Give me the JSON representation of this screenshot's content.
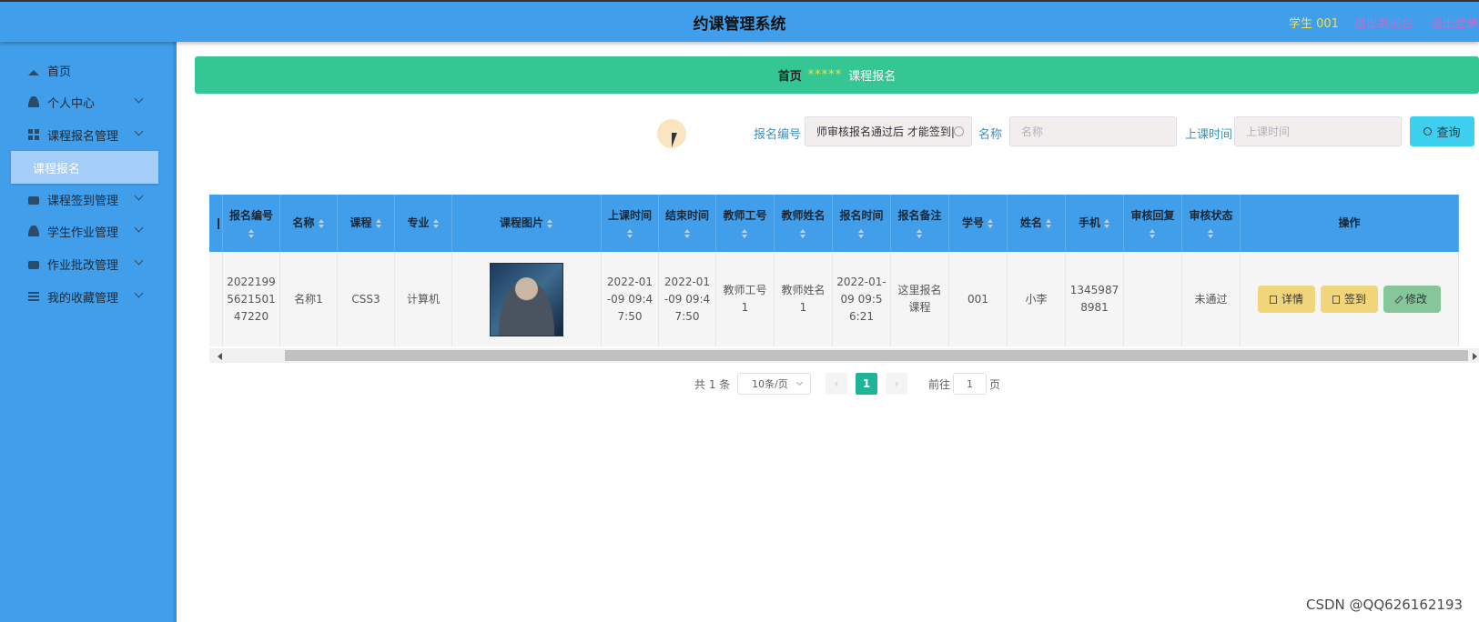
{
  "header": {
    "title": "约课管理系统",
    "user": "学生 001",
    "front_link": "退出到前台",
    "logout_link": "退出登录"
  },
  "sidebar": {
    "items": [
      {
        "label": "首页",
        "icon": "home-icon"
      },
      {
        "label": "个人中心",
        "icon": "user-icon"
      },
      {
        "label": "课程报名管理",
        "icon": "grid-icon"
      },
      {
        "label": "课程报名",
        "icon": ""
      },
      {
        "label": "课程签到管理",
        "icon": "briefcase-icon"
      },
      {
        "label": "学生作业管理",
        "icon": "user-icon"
      },
      {
        "label": "作业批改管理",
        "icon": "briefcase-icon"
      },
      {
        "label": "我的收藏管理",
        "icon": "list-icon"
      }
    ]
  },
  "breadcrumb": {
    "home": "首页",
    "separator": "*****",
    "current": "课程报名"
  },
  "search": {
    "field1_label": "报名编号",
    "field1_value": "师审核报名通过后 才能签到|",
    "field2_label": "名称",
    "field2_placeholder": "名称",
    "field3_label": "上课时间",
    "field3_placeholder": "上课时间",
    "button": "查询"
  },
  "table": {
    "columns": [
      {
        "label": "",
        "sortable": false
      },
      {
        "label": "报名编号",
        "sortable": true
      },
      {
        "label": "名称",
        "sortable": true
      },
      {
        "label": "课程",
        "sortable": true
      },
      {
        "label": "专业",
        "sortable": true
      },
      {
        "label": "课程图片",
        "sortable": true
      },
      {
        "label": "上课时间",
        "sortable": true
      },
      {
        "label": "结束时间",
        "sortable": true
      },
      {
        "label": "教师工号",
        "sortable": true
      },
      {
        "label": "教师姓名",
        "sortable": true
      },
      {
        "label": "报名时间",
        "sortable": true
      },
      {
        "label": "报名备注",
        "sortable": true
      },
      {
        "label": "学号",
        "sortable": true
      },
      {
        "label": "姓名",
        "sortable": true
      },
      {
        "label": "手机",
        "sortable": true
      },
      {
        "label": "审核回复",
        "sortable": true
      },
      {
        "label": "审核状态",
        "sortable": true
      },
      {
        "label": "操作",
        "sortable": false
      }
    ],
    "rows": [
      {
        "cells": [
          "",
          "20221995621501 47220",
          "名称1",
          "CSS3",
          "计算机",
          "",
          "2022-01-09 09:47:50",
          "2022-01-09 09:47:50",
          "教师工号1",
          "教师姓名1",
          "2022-01-09 09:56:21",
          "这里报名课程",
          "001",
          "小李",
          "13459878981",
          "",
          "未通过",
          ""
        ],
        "actions": [
          "详情",
          "签到",
          "修改"
        ]
      }
    ]
  },
  "pagination": {
    "total": "共 1 条",
    "page_size": "10条/页",
    "current_page": "1",
    "goto_label": "前往",
    "goto_value": "1",
    "page_unit": "页"
  },
  "watermark": "CSDN @QQ626162193",
  "colors": {
    "topbar": "#409eea",
    "sidebar": "#409eea",
    "breadcrumb": "#34c794",
    "search_button": "#3cd0ee",
    "detail_button": "#f0d57a",
    "edit_button": "#86c79a",
    "active_page": "#20b397"
  }
}
